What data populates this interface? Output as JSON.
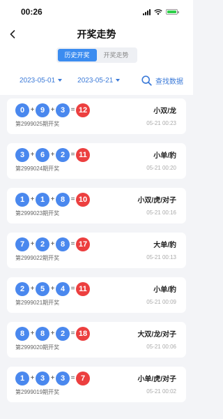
{
  "status": {
    "time": "00:26"
  },
  "header": {
    "title": "开奖走势"
  },
  "tabs": [
    {
      "label": "历史开奖",
      "active": true
    },
    {
      "label": "开奖走势",
      "active": false
    }
  ],
  "filter": {
    "start_date": "2023-05-01",
    "end_date": "2023-05-21",
    "search_label": "查找数据"
  },
  "draws": [
    {
      "n1": "0",
      "n2": "9",
      "n3": "3",
      "sum": "12",
      "result": "小双/龙",
      "period": "第2999025期开奖",
      "time": "05-21 00:23"
    },
    {
      "n1": "3",
      "n2": "6",
      "n3": "2",
      "sum": "11",
      "result": "小单/豹",
      "period": "第2999024期开奖",
      "time": "05-21 00:20"
    },
    {
      "n1": "1",
      "n2": "1",
      "n3": "8",
      "sum": "10",
      "result": "小双/虎/对子",
      "period": "第2999023期开奖",
      "time": "05-21 00:16"
    },
    {
      "n1": "7",
      "n2": "2",
      "n3": "8",
      "sum": "17",
      "result": "大单/豹",
      "period": "第2999022期开奖",
      "time": "05-21 00:13"
    },
    {
      "n1": "2",
      "n2": "5",
      "n3": "4",
      "sum": "11",
      "result": "小单/豹",
      "period": "第2999021期开奖",
      "time": "05-21 00:09"
    },
    {
      "n1": "8",
      "n2": "8",
      "n3": "2",
      "sum": "18",
      "result": "大双/龙/对子",
      "period": "第2999020期开奖",
      "time": "05-21 00:06"
    },
    {
      "n1": "1",
      "n2": "3",
      "n3": "3",
      "sum": "7",
      "result": "小单/虎/对子",
      "period": "第2999019期开奖",
      "time": "05-21 00:02"
    }
  ],
  "operators": {
    "plus": "+",
    "equals": "="
  },
  "colors": {
    "accent": "#3b8cf0",
    "ball_blue": "#4a88ee",
    "ball_red": "#ec3f3f"
  }
}
